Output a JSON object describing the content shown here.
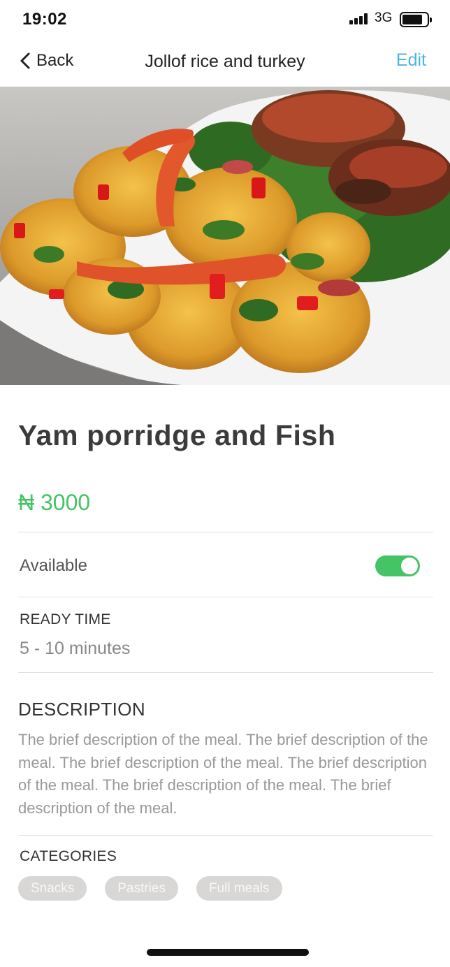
{
  "status_bar": {
    "time": "19:02",
    "network": "3G"
  },
  "nav": {
    "back_label": "Back",
    "title": "Jollof rice and turkey",
    "edit_label": "Edit"
  },
  "meal": {
    "name": "Yam porridge and Fish",
    "price": "₦ 3000",
    "available_label": "Available",
    "available": true,
    "ready_time_heading": "READY TIME",
    "ready_time": "5 - 10 minutes",
    "description_heading": "DESCRIPTION",
    "description": "The brief description of the meal. The brief description of the meal. The brief description of the meal.  The brief description of the meal.  The brief description of the meal.  The brief description of the meal.",
    "categories_heading": "CATEGORIES",
    "categories": [
      "Snacks",
      "Pastries",
      "Full meals"
    ]
  },
  "colors": {
    "accent_blue": "#4cb4e0",
    "accent_green": "#45c466",
    "chip_bg": "#d9d6d6"
  },
  "icons": {
    "back": "chevron-left-icon",
    "signal": "signal-icon",
    "battery": "battery-icon"
  }
}
